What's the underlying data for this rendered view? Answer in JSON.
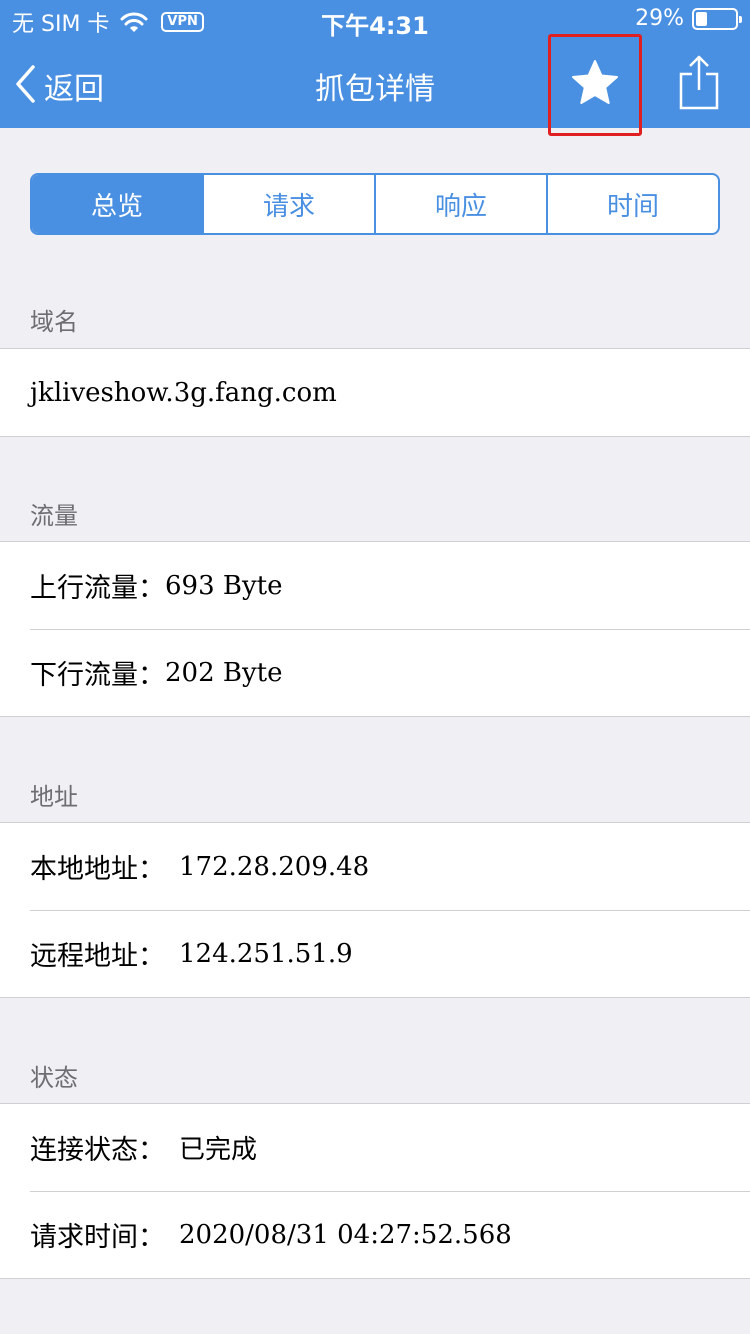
{
  "status_bar": {
    "carrier": "无 SIM 卡",
    "vpn": "VPN",
    "time": "下午4:31",
    "battery_percent": "29%",
    "battery_level": 0.29
  },
  "nav": {
    "back_label": "返回",
    "title": "抓包详情",
    "favorite_icon": "star-icon",
    "share_icon": "share-icon"
  },
  "tabs": [
    {
      "label": "总览",
      "active": true
    },
    {
      "label": "请求",
      "active": false
    },
    {
      "label": "响应",
      "active": false
    },
    {
      "label": "时间",
      "active": false
    }
  ],
  "sections": {
    "domain": {
      "header": "域名",
      "value": "jkliveshow.3g.fang.com"
    },
    "traffic": {
      "header": "流量",
      "rows": [
        {
          "label": "上行流量：",
          "value": "693 Byte"
        },
        {
          "label": "下行流量：",
          "value": "202 Byte"
        }
      ]
    },
    "address": {
      "header": "地址",
      "rows": [
        {
          "label": "本地地址：",
          "value": "172.28.209.48"
        },
        {
          "label": "远程地址：",
          "value": "124.251.51.9"
        }
      ]
    },
    "status": {
      "header": "状态",
      "rows": [
        {
          "label": "连接状态：",
          "value": "已完成"
        },
        {
          "label": "请求时间：",
          "value": "2020/08/31 04:27:52.568"
        }
      ]
    }
  },
  "colors": {
    "brand": "#4a90e2",
    "highlight_box": "#e02020",
    "background": "#efeff4"
  }
}
